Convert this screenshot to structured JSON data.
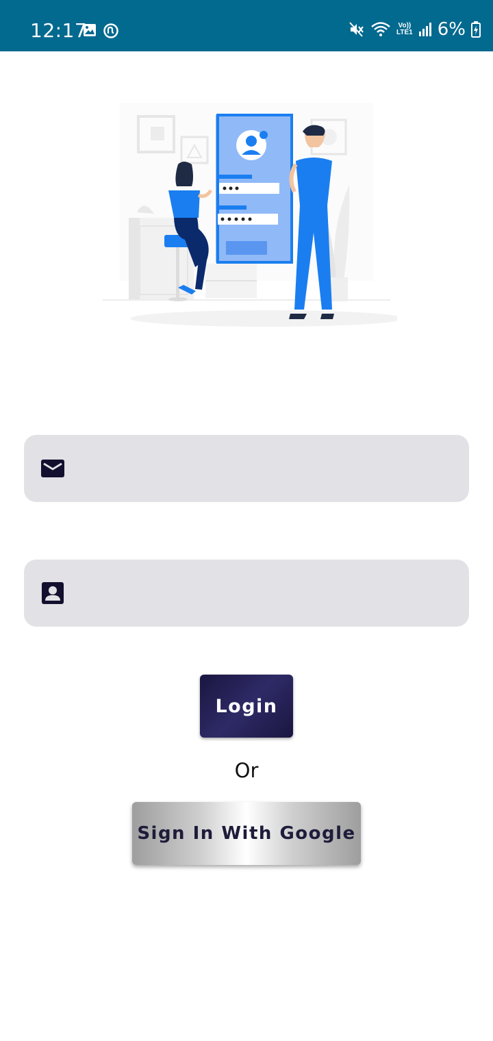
{
  "status_bar": {
    "time": "12:17",
    "battery": "6%",
    "network": "LTE1",
    "volte": "Vo))",
    "icons": [
      "image-icon",
      "app-notification-icon",
      "mute-icon",
      "wifi-icon",
      "signal-icon",
      "battery-charging-icon"
    ],
    "background_color": "#02698f"
  },
  "hero": {
    "illustration": "login-illustration",
    "accent_color": "#1a7ef0"
  },
  "form": {
    "email": {
      "icon": "mail-icon",
      "value": "",
      "placeholder": ""
    },
    "password": {
      "icon": "contact-icon",
      "value": "",
      "placeholder": ""
    }
  },
  "actions": {
    "login_label": "Login",
    "or_label": "Or",
    "google_label": "Sign In With Google"
  },
  "colors": {
    "field_background": "#e2e1e6",
    "login_button": "#1f1b4d",
    "icon_dark": "#12102e"
  }
}
